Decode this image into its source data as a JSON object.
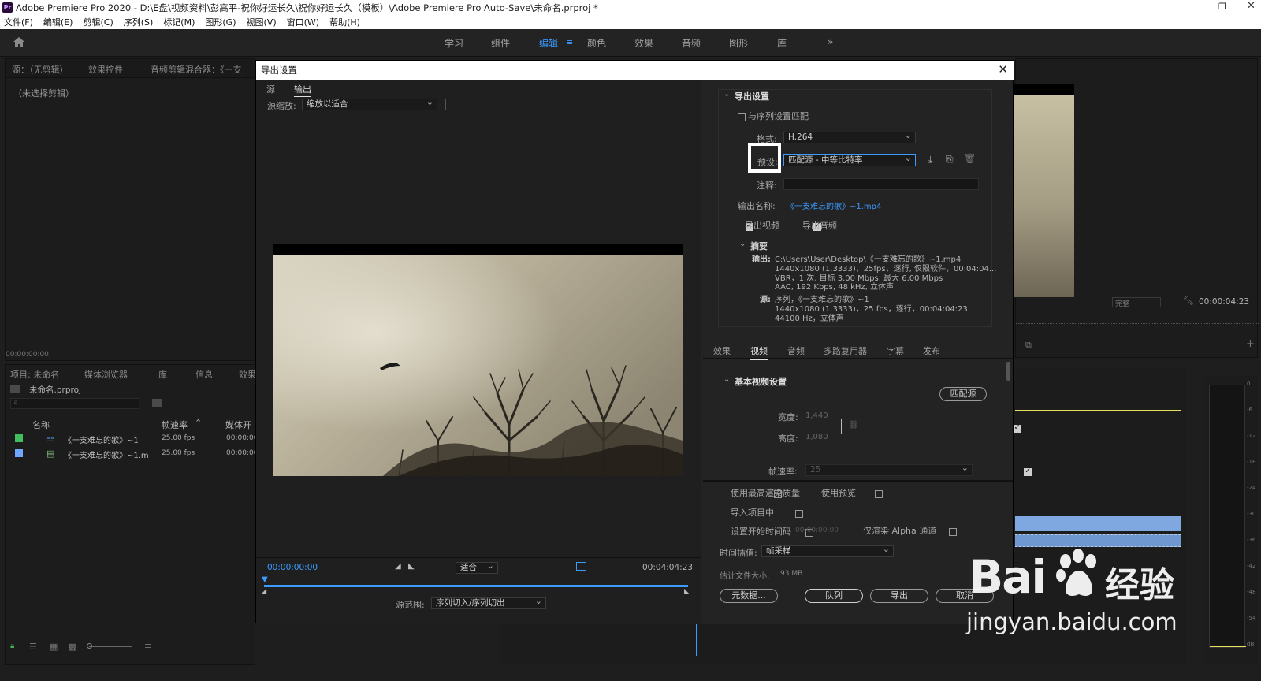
{
  "window": {
    "title": "Adobe Premiere Pro 2020 - D:\\E盘\\视频资料\\彭高平-祝你好运长久\\祝你好运长久（模板）\\Adobe Premiere Pro Auto-Save\\未命名.prproj *",
    "app_badge": "Pr",
    "min_glyph": "—",
    "max_glyph": "❐",
    "close_glyph": "✕"
  },
  "menu": [
    "文件(F)",
    "编辑(E)",
    "剪辑(C)",
    "序列(S)",
    "标记(M)",
    "图形(G)",
    "视图(V)",
    "窗口(W)",
    "帮助(H)"
  ],
  "workspaces": {
    "tabs": [
      "学习",
      "组件",
      "编辑",
      "颜色",
      "效果",
      "音频",
      "图形",
      "库"
    ],
    "active": "编辑",
    "overflow": "»"
  },
  "source_panel": {
    "tabs": [
      "源：（无剪辑）",
      "效果控件",
      "音频剪辑混合器：《一支"
    ],
    "empty_label": "（未选择剪辑）",
    "timecode": "00:00:00:00"
  },
  "project_panel": {
    "tabs": [
      "项目: 未命名",
      "媒体浏览器",
      "库",
      "信息",
      "效果"
    ],
    "project_name": "未命名.prproj",
    "columns": [
      "名称",
      "帧速率",
      "媒体开"
    ],
    "rows": [
      {
        "name": "《一支难忘的歌》~1",
        "fps": "25.00 fps",
        "start": "00:00:00",
        "color": "#3fbf5f"
      },
      {
        "name": "《一支难忘的歌》~1.m",
        "fps": "25.00 fps",
        "start": "00:00:00",
        "color": "#6fa6ff"
      }
    ]
  },
  "program_monitor": {
    "fit_label": "完整",
    "timecode": "00:00:04:23"
  },
  "audio_meter": {
    "scale": [
      "0",
      "-6",
      "-12",
      "-18",
      "-24",
      "-30",
      "-36",
      "-42",
      "-48",
      "-54",
      "dB"
    ]
  },
  "export_dialog": {
    "title": "导出设置",
    "close_glyph": "✕",
    "left_tabs": [
      "源",
      "输出"
    ],
    "active_left_tab": "输出",
    "source_scaling_label": "源缩放:",
    "source_scaling_value": "缩放以适合",
    "timecode_start": "00:00:00:00",
    "timecode_end": "00:04:04:23",
    "fit_value": "适合",
    "range_label": "源范围:",
    "range_value": "序列切入/序列切出",
    "export_settings": {
      "header": "导出设置",
      "match_sequence": "与序列设置匹配",
      "format_label": "格式:",
      "format_value": "H.264",
      "preset_label": "预设:",
      "preset_value": "匹配源 - 中等比特率",
      "comment_label": "注释:",
      "output_name_label": "输出名称:",
      "output_name_value": "《一支难忘的歌》~1.mp4",
      "export_video": "导出视频",
      "export_audio": "导出音频",
      "summary_header": "摘要",
      "output_label": "输出:",
      "output_lines": [
        "C:\\Users\\User\\Desktop\\《一支难忘的歌》~1.mp4",
        "1440x1080 (1.3333)，25fps，逐行, 仅限软件，00:04:04...",
        "VBR，1 次, 目标 3.00 Mbps, 最大 6.00 Mbps",
        "AAC, 192 Kbps, 48  kHz, 立体声"
      ],
      "source_label": "源:",
      "source_lines": [
        "序列，《一支难忘的歌》~1",
        "1440x1080 (1.3333)，25 fps，逐行，00:04:04:23",
        "44100 Hz，立体声"
      ]
    },
    "settings_tabs": [
      "效果",
      "视频",
      "音频",
      "多路复用器",
      "字幕",
      "发布"
    ],
    "active_settings_tab": "视频",
    "basic_video": {
      "header": "基本视频设置",
      "match_source_button": "匹配源",
      "width_label": "宽度:",
      "width_value": "1,440",
      "height_label": "高度:",
      "height_value": "1,080",
      "frame_rate_label": "帧速率:",
      "frame_rate_value": "25"
    },
    "bottom": {
      "max_render_quality": "使用最高渲染质量",
      "use_previews": "使用预览",
      "import_into_project": "导入项目中",
      "set_start_timecode": "设置开始时间码",
      "start_timecode_value": "00:00:00:00",
      "render_alpha_only": "仅渲染 Alpha 通道",
      "time_interpolation_label": "时间插值:",
      "time_interpolation_value": "帧采样",
      "file_size_label": "估计文件大小:",
      "file_size_value": "93 MB",
      "metadata_button": "元数据...",
      "queue_button": "队列",
      "export_button": "导出",
      "cancel_button": "取消"
    }
  },
  "watermark": {
    "text_bai": "Bai",
    "text_du": "经验",
    "url": "jingyan.baidu.com"
  },
  "colors": {
    "accent": "#3b9bff",
    "panel_bg": "#1c1c1c",
    "dialog_bg": "#232323",
    "audio_clip": "#7fa8e0",
    "meter_line": "#e6e05a"
  }
}
